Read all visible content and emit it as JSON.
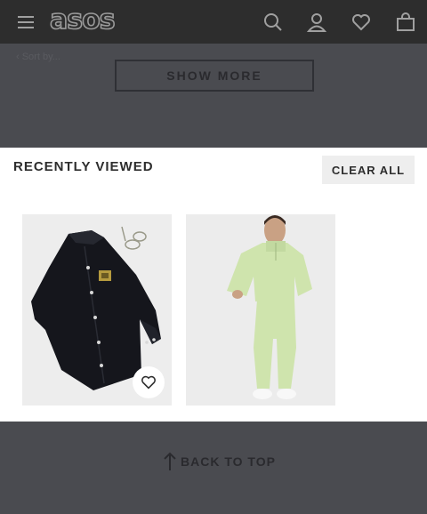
{
  "header": {
    "logo_text": "asos",
    "icons": [
      "menu-icon",
      "search-icon",
      "account-icon",
      "saved-items-icon",
      "bag-icon"
    ]
  },
  "background": {
    "faint_label": "‹ Sort by...",
    "show_more_label": "SHOW MORE"
  },
  "recently_viewed": {
    "title": "RECENTLY VIEWED",
    "clear_label": "CLEAR ALL"
  },
  "footer": {
    "back_to_top_label": "BACK TO TOP"
  },
  "colors": {
    "header_bg": "#2d2d2d",
    "overlay_bg": "#4a4b50",
    "panel_bg": "#ffffff",
    "button_bg": "#eeeeee"
  }
}
